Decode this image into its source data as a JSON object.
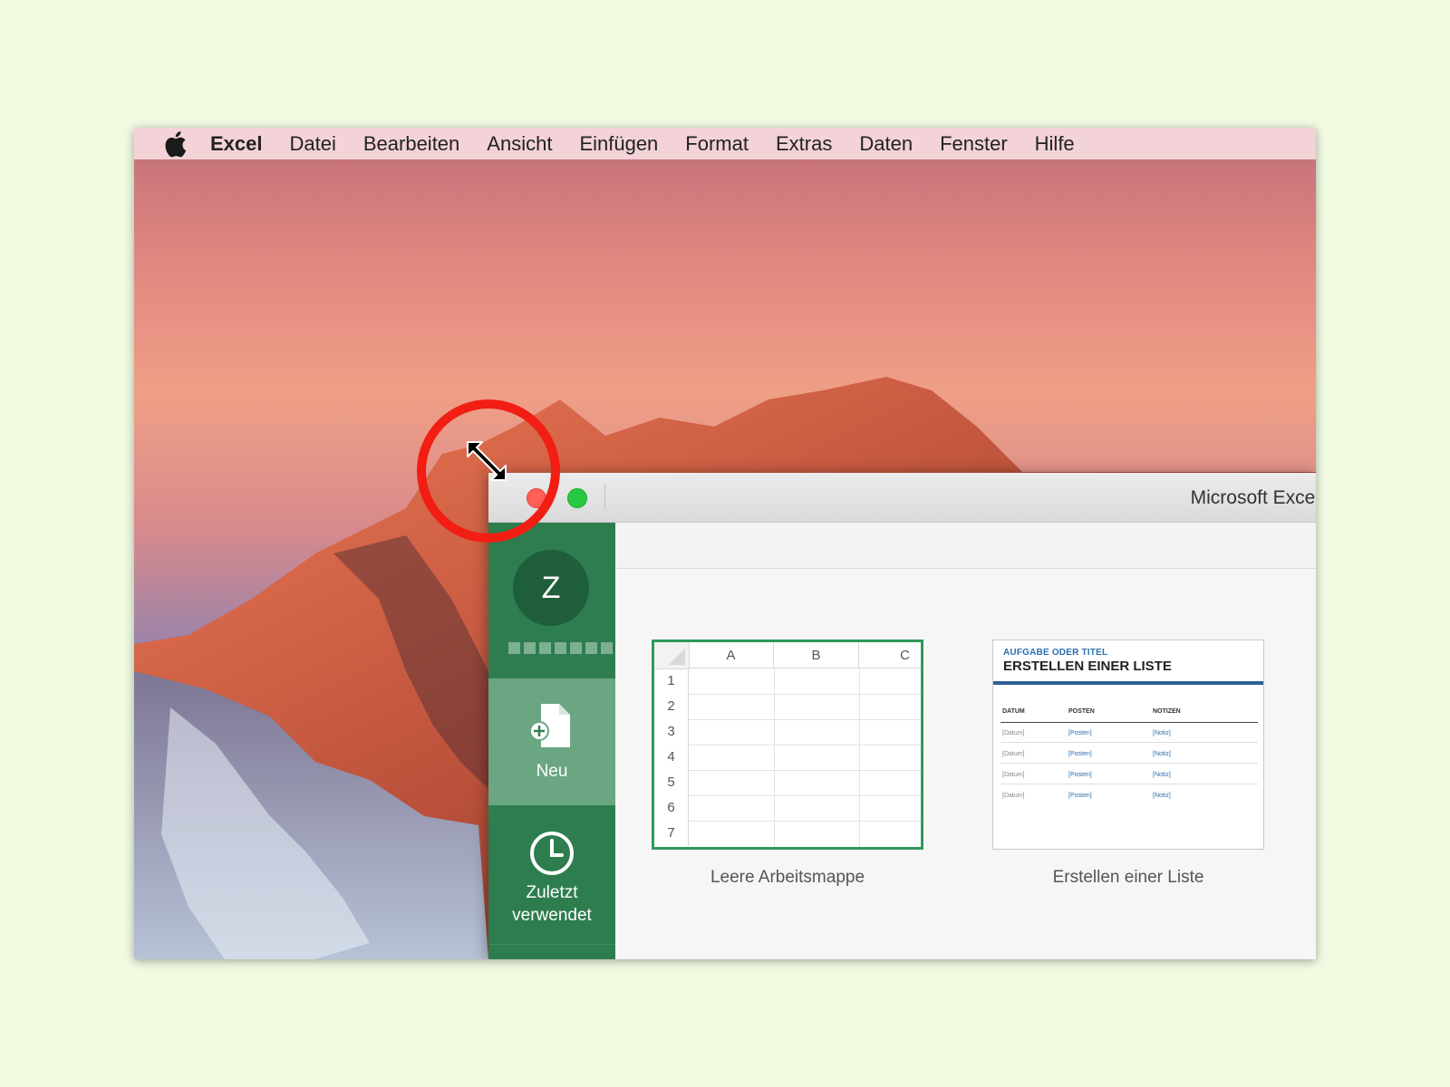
{
  "menubar": {
    "apple_icon": "apple-logo-icon",
    "app_name": "Excel",
    "items": [
      "Datei",
      "Bearbeiten",
      "Ansicht",
      "Einfügen",
      "Format",
      "Extras",
      "Daten",
      "Fenster",
      "Hilfe"
    ]
  },
  "window": {
    "title": "Microsoft Excel",
    "traffic_lights": [
      "close",
      "zoom"
    ]
  },
  "sidebar": {
    "avatar_initial": "Z",
    "user_name_blurred": true,
    "nav": [
      {
        "label": "Neu",
        "icon": "new-document-icon",
        "active": true
      },
      {
        "label": "Zuletzt verwendet",
        "line1": "Zuletzt",
        "line2": "verwendet",
        "icon": "clock-icon",
        "active": false
      }
    ]
  },
  "templates": {
    "blank": {
      "caption": "Leere Arbeitsmappe",
      "columns": [
        "A",
        "B",
        "C"
      ],
      "rows": [
        "1",
        "2",
        "3",
        "4",
        "5",
        "6",
        "7"
      ]
    },
    "list": {
      "caption": "Erstellen einer Liste",
      "subtitle": "AUFGABE ODER TITEL",
      "title": "ERSTELLEN EINER LISTE",
      "headers": [
        "DATUM",
        "POSTEN",
        "NOTIZEN"
      ],
      "rows": [
        [
          "[Datum]",
          "[Posten]",
          "[Notiz]"
        ],
        [
          "[Datum]",
          "[Posten]",
          "[Notiz]"
        ],
        [
          "[Datum]",
          "[Posten]",
          "[Notiz]"
        ],
        [
          "[Datum]",
          "[Posten]",
          "[Notiz]"
        ]
      ]
    }
  },
  "overlay": {
    "cursor": "diagonal-resize-cursor-icon",
    "highlight_color": "#f21d13"
  },
  "colors": {
    "sidebar_green": "#2e7d4f",
    "active_nav": "#6aa682",
    "menubar": "#f3d3d7",
    "background": "#f0fbe2"
  }
}
